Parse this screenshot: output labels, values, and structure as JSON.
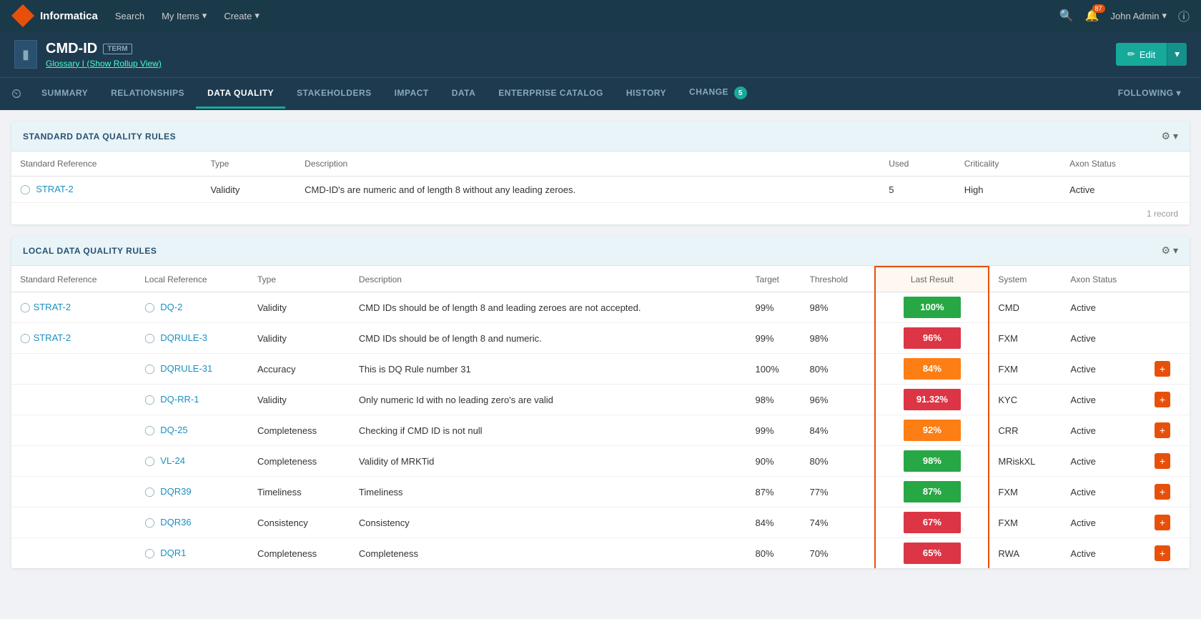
{
  "app": {
    "name": "Informatica"
  },
  "topNav": {
    "links": [
      {
        "label": "Search",
        "hasArrow": false
      },
      {
        "label": "My Items",
        "hasArrow": true
      },
      {
        "label": "Create",
        "hasArrow": true
      }
    ],
    "notificationCount": "87",
    "user": "John Admin"
  },
  "header": {
    "itemId": "CMD-ID",
    "itemBadge": "TERM",
    "subtitle": "Glossary I (Show Rollup View)",
    "editLabel": "Edit"
  },
  "tabs": [
    {
      "label": "SUMMARY",
      "active": false
    },
    {
      "label": "RELATIONSHIPS",
      "active": false
    },
    {
      "label": "DATA QUALITY",
      "active": true
    },
    {
      "label": "STAKEHOLDERS",
      "active": false
    },
    {
      "label": "IMPACT",
      "active": false
    },
    {
      "label": "DATA",
      "active": false
    },
    {
      "label": "ENTERPRISE CATALOG",
      "active": false
    },
    {
      "label": "HISTORY",
      "active": false
    },
    {
      "label": "CHANGE",
      "active": false,
      "badge": "5"
    },
    {
      "label": "FOLLOWING",
      "active": false,
      "hasArrow": true
    }
  ],
  "standardSection": {
    "title": "STANDARD DATA QUALITY RULES",
    "columns": [
      "Standard Reference",
      "Type",
      "Description",
      "Used",
      "Criticality",
      "Axon Status"
    ],
    "rows": [
      {
        "ref": "STRAT-2",
        "type": "Validity",
        "description": "CMD-ID's are numeric and of length 8 without any leading zeroes.",
        "used": "5",
        "criticality": "High",
        "axonStatus": "Active"
      }
    ],
    "recordCount": "1 record"
  },
  "localSection": {
    "title": "LOCAL DATA QUALITY RULES",
    "columns": [
      "Standard Reference",
      "Local Reference",
      "Type",
      "Description",
      "Target",
      "Threshold",
      "Last Result",
      "System",
      "Axon Status",
      ""
    ],
    "rows": [
      {
        "stdRef": "STRAT-2",
        "localRef": "DQ-2",
        "type": "Validity",
        "description": "CMD IDs should be of length 8 and leading zeroes are not accepted.",
        "target": "99%",
        "threshold": "98%",
        "lastResult": "100%",
        "resultColor": "green",
        "system": "CMD",
        "axonStatus": "Active",
        "hasPlus": false
      },
      {
        "stdRef": "STRAT-2",
        "localRef": "DQRULE-3",
        "type": "Validity",
        "description": "CMD IDs should be of length 8 and numeric.",
        "target": "99%",
        "threshold": "98%",
        "lastResult": "96%",
        "resultColor": "red",
        "system": "FXM",
        "axonStatus": "Active",
        "hasPlus": false
      },
      {
        "stdRef": "",
        "localRef": "DQRULE-31",
        "type": "Accuracy",
        "description": "This is DQ Rule number 31",
        "target": "100%",
        "threshold": "80%",
        "lastResult": "84%",
        "resultColor": "orange",
        "system": "FXM",
        "axonStatus": "Active",
        "hasPlus": true
      },
      {
        "stdRef": "",
        "localRef": "DQ-RR-1",
        "type": "Validity",
        "description": "Only numeric Id with no leading zero's are valid",
        "target": "98%",
        "threshold": "96%",
        "lastResult": "91.32%",
        "resultColor": "red",
        "system": "KYC",
        "axonStatus": "Active",
        "hasPlus": true
      },
      {
        "stdRef": "",
        "localRef": "DQ-25",
        "type": "Completeness",
        "description": "Checking if CMD ID is not null",
        "target": "99%",
        "threshold": "84%",
        "lastResult": "92%",
        "resultColor": "orange",
        "system": "CRR",
        "axonStatus": "Active",
        "hasPlus": true
      },
      {
        "stdRef": "",
        "localRef": "VL-24",
        "type": "Completeness",
        "description": "Validity of MRKTid",
        "target": "90%",
        "threshold": "80%",
        "lastResult": "98%",
        "resultColor": "green",
        "system": "MRiskXL",
        "axonStatus": "Active",
        "hasPlus": true
      },
      {
        "stdRef": "",
        "localRef": "DQR39",
        "type": "Timeliness",
        "description": "Timeliness",
        "target": "87%",
        "threshold": "77%",
        "lastResult": "87%",
        "resultColor": "green",
        "system": "FXM",
        "axonStatus": "Active",
        "hasPlus": true
      },
      {
        "stdRef": "",
        "localRef": "DQR36",
        "type": "Consistency",
        "description": "Consistency",
        "target": "84%",
        "threshold": "74%",
        "lastResult": "67%",
        "resultColor": "red",
        "system": "FXM",
        "axonStatus": "Active",
        "hasPlus": true
      },
      {
        "stdRef": "",
        "localRef": "DQR1",
        "type": "Completeness",
        "description": "Completeness",
        "target": "80%",
        "threshold": "70%",
        "lastResult": "65%",
        "resultColor": "red",
        "system": "RWA",
        "axonStatus": "Active",
        "hasPlus": true
      }
    ]
  }
}
